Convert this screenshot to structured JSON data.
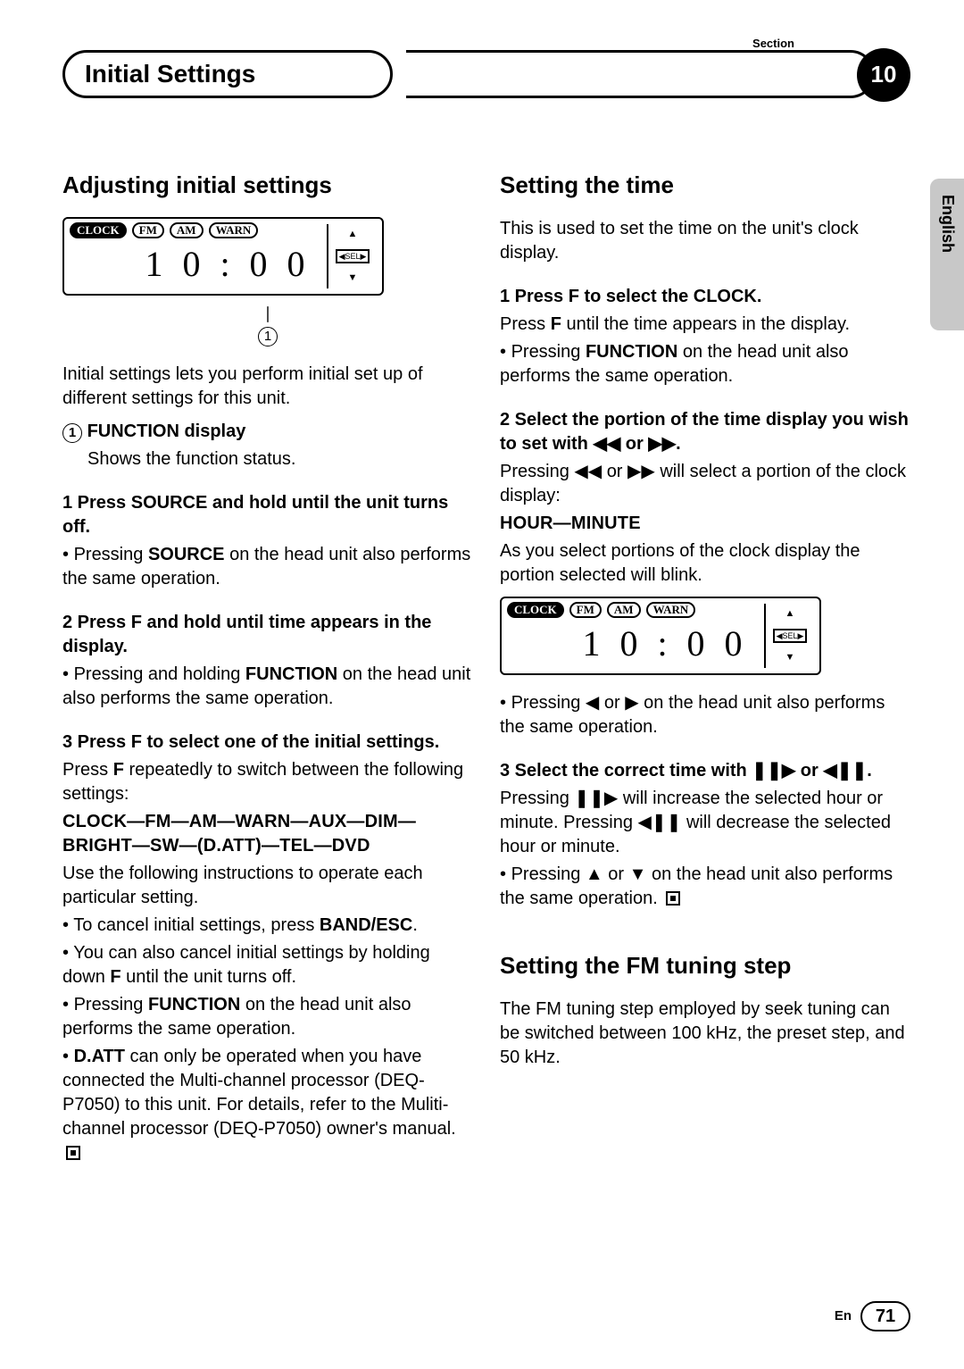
{
  "header": {
    "section_label": "Section",
    "title": "Initial Settings",
    "section_number": "10"
  },
  "sidebar": {
    "language": "English"
  },
  "footer": {
    "lang_code": "En",
    "page_number": "71"
  },
  "lcd": {
    "labels": {
      "clock": "CLOCK",
      "fm": "FM",
      "am": "AM",
      "warn": "WARN",
      "sel": "SEL"
    },
    "time": "1 0 : 0 0",
    "callout": "1"
  },
  "left": {
    "h2": "Adjusting initial settings",
    "intro": "Initial settings lets you perform initial set up of different settings for this unit.",
    "callout_title": "FUNCTION display",
    "callout_body": "Shows the function status.",
    "step1": "1   Press SOURCE and hold until the unit turns off.",
    "step1_b1a": "Pressing ",
    "step1_b1_bold": "SOURCE",
    "step1_b1b": " on the head unit also performs the same operation.",
    "step2": "2   Press F and hold until time appears in the display.",
    "step2_b1a": "Pressing and holding ",
    "step2_b1_bold": "FUNCTION",
    "step2_b1b": " on the head unit also performs the same operation.",
    "step3": "3   Press F to select one of the initial settings.",
    "step3_p1a": "Press ",
    "step3_p1_bold": "F",
    "step3_p1b": " repeatedly to switch between the following settings:",
    "seq": "CLOCK—FM—AM—WARN—AUX—DIM—BRIGHT—SW—(D.ATT)—TEL—DVD",
    "step3_p2": "Use the following instructions to operate each particular setting.",
    "step3_b1a": "To cancel initial settings, press ",
    "step3_b1_bold": "BAND/ESC",
    "step3_b1b": ".",
    "step3_b2a": "You can also cancel initial settings by holding down ",
    "step3_b2_bold": "F",
    "step3_b2b": " until the unit turns off.",
    "step3_b3a": "Pressing ",
    "step3_b3_bold": "FUNCTION",
    "step3_b3b": " on the head unit also performs the same operation.",
    "step3_b4_bold": "D.ATT",
    "step3_b4": " can only be operated when you have connected the Multi-channel processor (DEQ-P7050) to this unit. For details, refer to the Muliti-channel processor (DEQ-P7050) owner's manual."
  },
  "right": {
    "h2a": "Setting the time",
    "intro": "This is used to set the time on the unit's clock display.",
    "step1": "1   Press F to select the CLOCK.",
    "step1_p1a": "Press ",
    "step1_p1_bold": "F",
    "step1_p1b": " until the time appears in the display.",
    "step1_b1a": "Pressing ",
    "step1_b1_bold": "FUNCTION",
    "step1_b1b": " on the head unit also performs the same operation.",
    "step2": "2   Select the portion of the time display you wish to set with ◀◀ or ▶▶.",
    "step2_p1": "Pressing ◀◀ or ▶▶ will select a portion of the clock display:",
    "step2_seq": "HOUR—MINUTE",
    "step2_p2": "As you select portions of the clock display the portion selected will blink.",
    "step2_b1": "Pressing ◀ or ▶ on the head unit also performs the same operation.",
    "step3": "3   Select the correct time with ❚❚▶ or ◀❚❚.",
    "step3_p1": "Pressing ❚❚▶ will increase the selected hour or minute. Pressing ◀❚❚ will decrease the selected hour or minute.",
    "step3_b1": "Pressing ▲ or ▼ on the head unit also performs the same operation.",
    "h2b": "Setting the FM tuning step",
    "fm_p1": "The FM tuning step employed by seek tuning can be switched between 100 kHz, the preset step, and 50 kHz."
  }
}
